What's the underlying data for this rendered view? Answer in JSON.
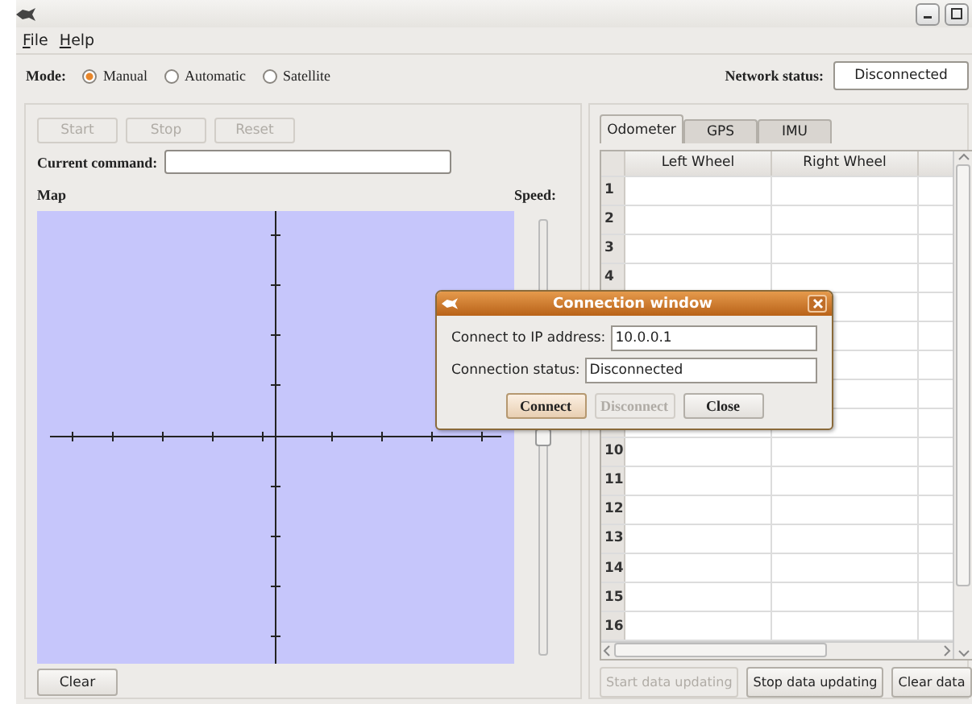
{
  "menu": [
    {
      "label": "File"
    },
    {
      "label": "Help"
    }
  ],
  "mode": {
    "label": "Mode:",
    "options": [
      {
        "label": "Manual",
        "selected": true
      },
      {
        "label": "Automatic",
        "selected": false
      },
      {
        "label": "Satellite",
        "selected": false
      }
    ]
  },
  "network_status": {
    "label": "Network status:",
    "value": "Disconnected"
  },
  "control_buttons": [
    {
      "label": "Start",
      "disabled": true
    },
    {
      "label": "Stop",
      "disabled": true
    },
    {
      "label": "Reset",
      "disabled": true
    }
  ],
  "current_command": {
    "label": "Current command:"
  },
  "map": {
    "label": "Map"
  },
  "speed": {
    "label": "Speed:",
    "level": 0.5
  },
  "clear_button": {
    "label": "Clear"
  },
  "tabs": [
    {
      "label": "Odometer",
      "selected": true
    },
    {
      "label": "GPS",
      "selected": false
    },
    {
      "label": "IMU",
      "selected": false
    }
  ],
  "table": {
    "columns": [
      "Left Wheel",
      "Right Wheel"
    ],
    "rows": [
      {
        "number": "1"
      },
      {
        "number": "2"
      },
      {
        "number": "3"
      },
      {
        "number": "4"
      },
      {},
      {},
      {},
      {},
      {},
      {
        "number": "10"
      },
      {
        "number": "11"
      },
      {
        "number": "12"
      },
      {
        "number": "13"
      },
      {
        "number": "14"
      },
      {
        "number": "15"
      },
      {
        "number": "16"
      }
    ]
  },
  "data_buttons": [
    {
      "label": "Start data updating",
      "disabled": true
    },
    {
      "label": "Stop data updating",
      "disabled": false
    },
    {
      "label": "Clear data",
      "disabled": false
    }
  ],
  "dialog": {
    "title": "Connection window",
    "fields": [
      {
        "label": "Connect to IP address:",
        "value": "10.0.0.1"
      },
      {
        "label": "Connection status:",
        "value": "Disconnected"
      }
    ],
    "buttons": [
      {
        "label": "Connect",
        "disabled": false,
        "focused": true
      },
      {
        "label": "Disconnect",
        "disabled": true,
        "focused": false
      },
      {
        "label": "Close",
        "disabled": false,
        "focused": false
      }
    ]
  }
}
